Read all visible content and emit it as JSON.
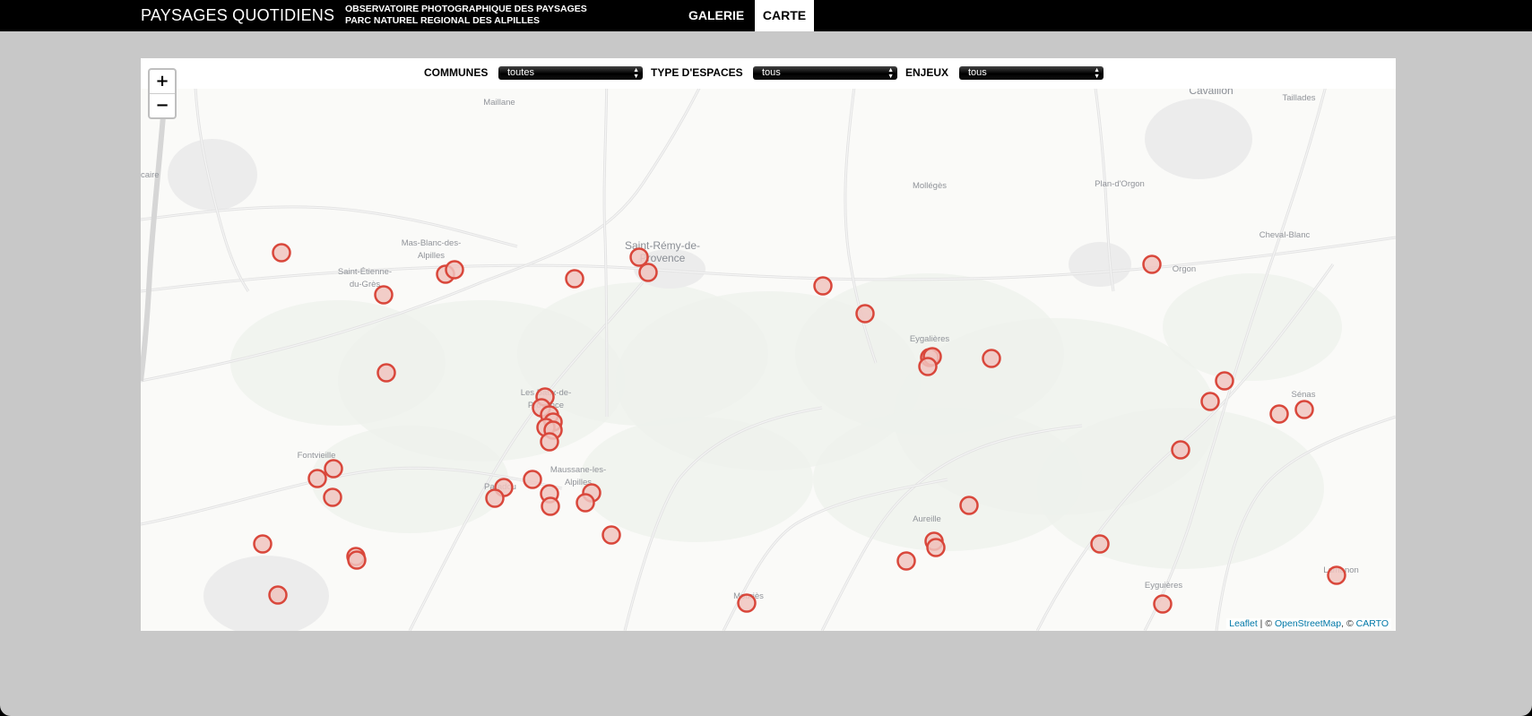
{
  "header": {
    "site_title": "PAYSAGES QUOTIDIENS",
    "subtitle_line1": "OBSERVATOIRE PHOTOGRAPHIQUE DES PAYSAGES",
    "subtitle_line2": "PARC NATUREL REGIONAL DES ALPILLES",
    "nav": [
      {
        "label": "GALERIE",
        "active": false
      },
      {
        "label": "CARTE",
        "active": true
      }
    ]
  },
  "filters": [
    {
      "label": "COMMUNES",
      "selected": "toutes"
    },
    {
      "label": "TYPE D'ESPACES",
      "selected": "tous"
    },
    {
      "label": "ENJEUX",
      "selected": "tous"
    }
  ],
  "map": {
    "zoom_in_label": "+",
    "zoom_out_label": "−",
    "marker_color": "#d9473b",
    "marker_fill": "#f0c4c0",
    "places": [
      {
        "name": "Maillane",
        "size": "small"
      },
      {
        "name": "Cavaillon",
        "size": "medium"
      },
      {
        "name": "Taillades",
        "size": "small"
      },
      {
        "name": "caire",
        "size": "small"
      },
      {
        "name": "Mollégès",
        "size": "small"
      },
      {
        "name": "Plan-d'Orgon",
        "size": "small"
      },
      {
        "name": "Cheval-Blanc",
        "size": "small"
      },
      {
        "name": "Orgon",
        "size": "small"
      },
      {
        "name": "Mas-Blanc-des-",
        "size": "small"
      },
      {
        "name": "Alpilles",
        "size": "small"
      },
      {
        "name": "Saint-Rémy-de-",
        "size": "medium"
      },
      {
        "name": "Provence",
        "size": "medium"
      },
      {
        "name": "Saint-Étienne-",
        "size": "small"
      },
      {
        "name": "du-Grès",
        "size": "small"
      },
      {
        "name": "Eygalières",
        "size": "small"
      },
      {
        "name": "Les Baux-de-",
        "size": "small"
      },
      {
        "name": "Provence",
        "size": "small"
      },
      {
        "name": "Sénas",
        "size": "small"
      },
      {
        "name": "Fontvieille",
        "size": "small"
      },
      {
        "name": "Maussane-les-",
        "size": "small"
      },
      {
        "name": "Alpilles",
        "size": "small"
      },
      {
        "name": "Paradou",
        "size": "small"
      },
      {
        "name": "Aureille",
        "size": "small"
      },
      {
        "name": "Lamanon",
        "size": "small"
      },
      {
        "name": "Eyguières",
        "size": "small"
      },
      {
        "name": "Mouriès",
        "size": "small"
      }
    ]
  },
  "attribution": {
    "leaflet": "Leaflet",
    "sep1": " | © ",
    "osm": "OpenStreetMap",
    "sep2": ", © ",
    "carto": "CARTO"
  }
}
